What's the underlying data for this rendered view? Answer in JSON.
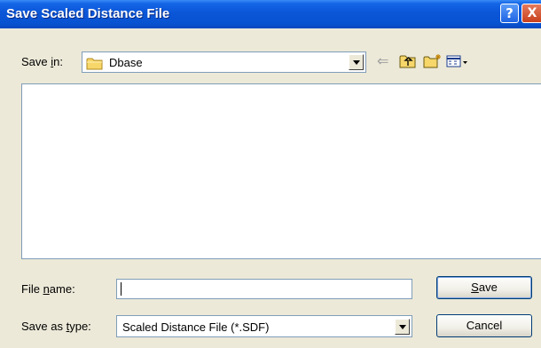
{
  "window": {
    "title": "Save Scaled Distance File",
    "help_glyph": "?",
    "close_glyph": "X"
  },
  "save_in": {
    "label_prefix": "Save ",
    "label_accel": "i",
    "label_suffix": "n:",
    "value": "Dbase",
    "icon": "folder-icon"
  },
  "toolbar": {
    "icons": [
      "back-arrow-icon",
      "up-one-level-icon",
      "new-folder-icon",
      "view-menu-icon"
    ]
  },
  "file_list": {
    "items": []
  },
  "file_name": {
    "label_prefix": "File ",
    "label_accel": "n",
    "label_suffix": "ame:",
    "value": ""
  },
  "save_as_type": {
    "label_prefix": "Save as ",
    "label_accel": "t",
    "label_suffix": "ype:",
    "value": "Scaled Distance File (*.SDF)"
  },
  "buttons": {
    "save_accel": "S",
    "save_rest": "ave",
    "cancel": "Cancel"
  },
  "colors": {
    "titlebar": "#0a56d8",
    "dialog_bg": "#ece9d8",
    "field_border": "#7f9db9",
    "close_button": "#c8401c"
  }
}
